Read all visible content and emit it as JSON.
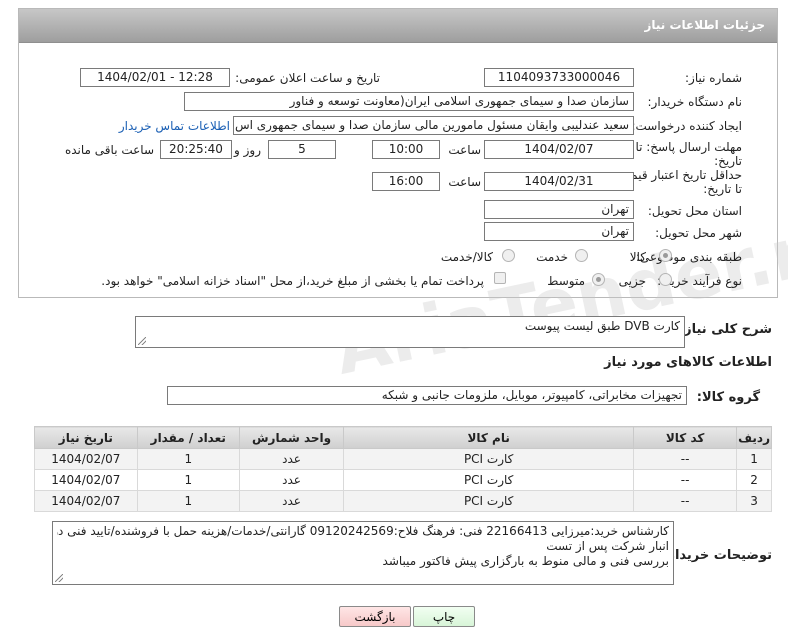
{
  "header": {
    "title": "جزئیات اطلاعات نیاز"
  },
  "fields": {
    "need_number_label": "شماره نیاز:",
    "need_number": "1104093733000046",
    "announce_label": "تاریخ و ساعت اعلان عمومی:",
    "announce_value": "1404/02/01 - 12:28",
    "buyer_org_label": "نام دستگاه خریدار:",
    "buyer_org": "سازمان صدا و سیمای جمهوری اسلامی ایران(معاونت توسعه و فناور",
    "creator_label": "ایجاد کننده درخواست:",
    "creator": "سعید عندلیبی وایقان مسئول مامورین مالی  سازمان صدا و سیمای جمهوری اس",
    "contact_link": "اطلاعات تماس خریدار",
    "deadline_label_1": "مهلت ارسال پاسخ: تا",
    "deadline_label_2": "تاریخ:",
    "deadline_date": "1404/02/07",
    "time_label": "ساعت",
    "deadline_time": "10:00",
    "days_value": "5",
    "days_label": "روز و",
    "remaining_value": "20:25:40",
    "remaining_label": "ساعت باقی مانده",
    "price_label_1": "حداقل تاریخ اعتبار قیمت:",
    "price_label_2": "تا تاریخ:",
    "price_date": "1404/02/31",
    "price_time_label": "ساعت",
    "price_time": "16:00",
    "province_label": "استان محل تحویل:",
    "province": "تهران",
    "city_label": "شهر محل تحویل:",
    "city": "تهران",
    "category_label": "طبقه بندی موضوعی:",
    "category_options": [
      "کالا",
      "خدمت",
      "کالا/خدمت"
    ],
    "process_label": "نوع فرآیند خرید :",
    "process_options": [
      "جزیی",
      "متوسط"
    ],
    "payment_note": "پرداخت تمام یا بخشی از مبلغ خرید،از محل \"اسناد خزانه اسلامی\" خواهد بود."
  },
  "summary": {
    "label": "شرح کلی نیاز:",
    "value": "کارت DVB طبق لیست پیوست"
  },
  "goods_section_title": "اطلاعات کالاهای مورد نیاز",
  "goods_group": {
    "label": "گروه کالا:",
    "value": "تجهیزات مخابراتی، کامپیوتر، موبایل، ملزومات جانبی و شبکه"
  },
  "table": {
    "headers": [
      "ردیف",
      "کد کالا",
      "نام کالا",
      "واحد شمارش",
      "تعداد / مقدار",
      "تاریخ نیاز"
    ],
    "rows": [
      [
        "1",
        "--",
        "کارت PCI",
        "عدد",
        "1",
        "1404/02/07"
      ],
      [
        "2",
        "--",
        "کارت PCI",
        "عدد",
        "1",
        "1404/02/07"
      ],
      [
        "3",
        "--",
        "کارت PCI",
        "عدد",
        "1",
        "1404/02/07"
      ]
    ]
  },
  "buyer_notes": {
    "label": "توضیحات خریدار:",
    "line1": "کارشناس خرید:میرزایی 22166413  فنی: فرهنگ فلاح:09120242569 گارانتی/خدمات/هزینه حمل با فروشنده/تایید فنی در",
    "line2": "انبار شرکت پس از تست",
    "line3": "بررسی فنی و مالی منوط به بارگزاری پیش فاکتور میباشد"
  },
  "buttons": {
    "print": "چاپ",
    "back": "بازگشت"
  },
  "watermark_text": "AriaTender.net"
}
